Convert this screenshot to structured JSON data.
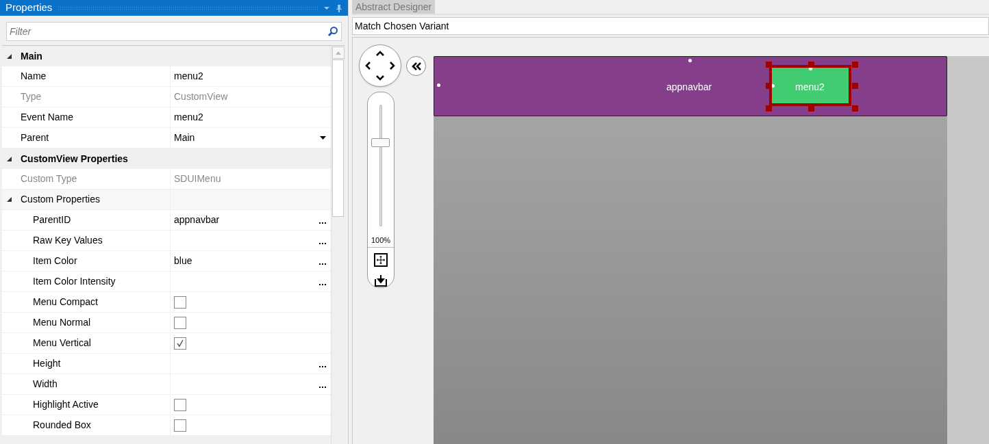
{
  "properties_panel": {
    "title": "Properties",
    "filter": {
      "placeholder": "Filter"
    },
    "categories": [
      {
        "label": "Main",
        "expanded": true,
        "items": [
          {
            "label": "Name",
            "value": "menu2",
            "kind": "text",
            "disabled": false
          },
          {
            "label": "Type",
            "value": "CustomView",
            "kind": "text",
            "disabled": true
          },
          {
            "label": "Event Name",
            "value": "menu2",
            "kind": "text",
            "disabled": false
          },
          {
            "label": "Parent",
            "value": "Main",
            "kind": "dropdown",
            "disabled": false
          }
        ]
      },
      {
        "label": "CustomView Properties",
        "expanded": true,
        "items": [
          {
            "label": "Custom Type",
            "value": "SDUIMenu",
            "kind": "text",
            "disabled": true
          },
          {
            "label": "Custom Properties",
            "kind": "group",
            "expanded": true,
            "disabled": false,
            "children": [
              {
                "label": "ParentID",
                "value": "appnavbar",
                "kind": "ellipsis",
                "disabled": false
              },
              {
                "label": "Raw Key Values",
                "kind": "ellipsis",
                "disabled": false
              },
              {
                "label": "Item Color",
                "value": "blue",
                "kind": "ellipsis",
                "disabled": false
              },
              {
                "label": "Item Color Intensity",
                "kind": "ellipsis",
                "disabled": false
              },
              {
                "label": "Menu Compact",
                "kind": "checkbox",
                "checked": false,
                "disabled": false
              },
              {
                "label": "Menu Normal",
                "kind": "checkbox",
                "checked": false,
                "disabled": false
              },
              {
                "label": "Menu Vertical",
                "kind": "checkbox",
                "checked": true,
                "disabled": false
              },
              {
                "label": "Height",
                "kind": "ellipsis",
                "disabled": false
              },
              {
                "label": "Width",
                "kind": "ellipsis",
                "disabled": false
              },
              {
                "label": "Highlight Active",
                "kind": "checkbox",
                "checked": false,
                "disabled": false
              },
              {
                "label": "Rounded Box",
                "kind": "checkbox",
                "checked": false,
                "disabled": false
              }
            ]
          }
        ]
      }
    ]
  },
  "designer": {
    "tabs": [
      {
        "label": "Abstract Designer",
        "selected": true
      }
    ],
    "variant": "Match Chosen Variant",
    "zoom": {
      "level": 0.69,
      "reading": "100%"
    },
    "views": [
      {
        "name": "appnavbar",
        "selected": false,
        "children": [
          {
            "name": "menu2",
            "selected": true
          }
        ]
      }
    ]
  }
}
